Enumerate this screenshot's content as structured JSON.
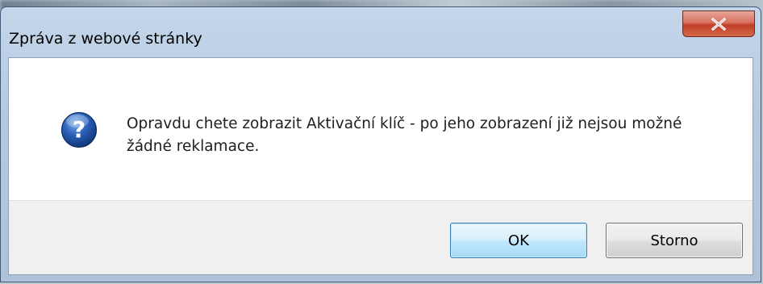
{
  "window": {
    "title": "Zpráva z webové stránky",
    "close_icon": "close-x-icon"
  },
  "message": {
    "icon": "question-icon",
    "text": "Opravdu chete zobrazit Aktivační klíč - po jeho zobrazení již nejsou možné žádné reklamace."
  },
  "buttons": {
    "ok_label": "OK",
    "cancel_label": "Storno"
  },
  "colors": {
    "close_button": "#c03f27",
    "ok_button_border": "#3c7fb1",
    "question_icon": "#2a5fb8"
  }
}
